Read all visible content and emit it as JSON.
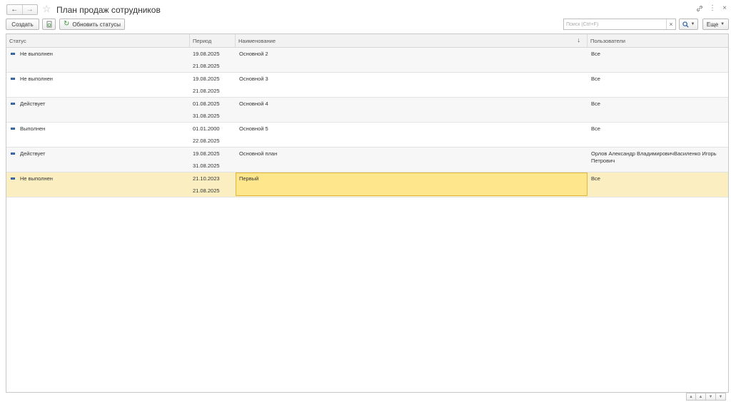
{
  "window": {
    "title": "План продаж сотрудников"
  },
  "toolbar": {
    "create_label": "Создать",
    "refresh_label": "Обновить статусы",
    "search_placeholder": "Поиск (Ctrl+F)",
    "search_clear": "×",
    "more_label": "Еще"
  },
  "table": {
    "columns": [
      "Статус",
      "Период",
      "Наименование",
      "Пользователи"
    ],
    "rows": [
      {
        "status": "Не выполнен",
        "period_start": "19.08.2025",
        "period_end": "21.08.2025",
        "name": "Основной 2",
        "users": "Все"
      },
      {
        "status": "Не выполнен",
        "period_start": "19.08.2025",
        "period_end": "21.08.2025",
        "name": "Основной 3",
        "users": "Все"
      },
      {
        "status": "Действует",
        "period_start": "01.08.2025",
        "period_end": "31.08.2025",
        "name": "Основной 4",
        "users": "Все"
      },
      {
        "status": "Выполнен",
        "period_start": "01.01.2000",
        "period_end": "22.08.2025",
        "name": "Основной 5",
        "users": "Все"
      },
      {
        "status": "Действует",
        "period_start": "19.08.2025",
        "period_end": "31.08.2025",
        "name": "Основной план",
        "users": "Орлов Александр ВладимировичВасиленко Игорь Петрович"
      },
      {
        "status": "Не выполнен",
        "period_start": "21.10.2023",
        "period_end": "21.08.2025",
        "name": "Первый",
        "users": "Все"
      }
    ],
    "selected_row_index": 5
  },
  "icons": {
    "back": "arrow-left-icon",
    "forward": "arrow-right-icon",
    "favorite": "star-icon",
    "link": "link-icon",
    "menu": "more-vertical-icon",
    "close": "close-icon",
    "copy": "copy-document-icon",
    "refresh": "refresh-icon",
    "search": "search-icon",
    "status": "status-marker-icon"
  },
  "colors": {
    "selected_row": "#fbefc2",
    "selected_cell": "#fde68b",
    "status_marker": "#4b79bd",
    "refresh_green": "#3a9a3a"
  }
}
